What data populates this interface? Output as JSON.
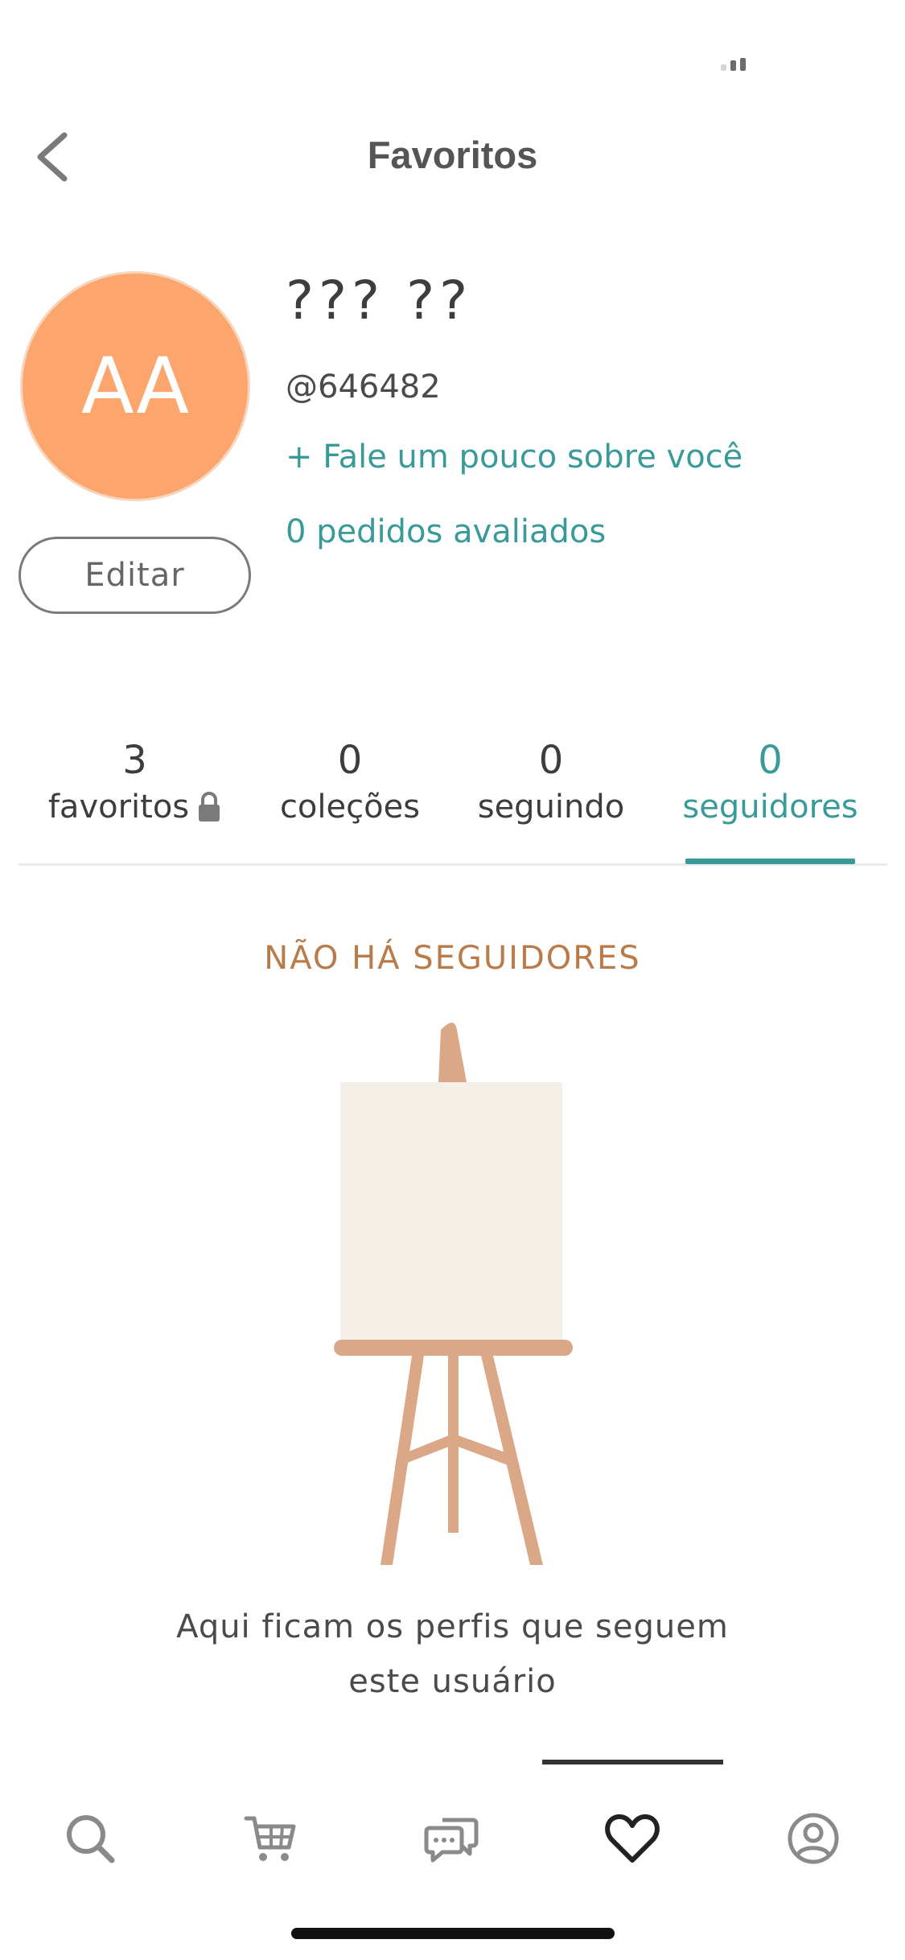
{
  "header": {
    "title": "Favoritos",
    "back_icon": "chevron-left-icon"
  },
  "profile": {
    "avatar_initials": "AA",
    "avatar_color": "#fca56c",
    "name": "??? ??",
    "handle": "@646482",
    "bio_link": "+ Fale um pouco sobre você",
    "reviews": "0 pedidos avaliados",
    "edit_label": "Editar"
  },
  "stats": {
    "favorites": {
      "count": "3",
      "label": "favoritos",
      "icon": "lock-icon"
    },
    "collections": {
      "count": "0",
      "label": "coleções"
    },
    "following": {
      "count": "0",
      "label": "seguindo"
    },
    "followers": {
      "count": "0",
      "label": "seguidores",
      "active": true
    }
  },
  "empty_state": {
    "title": "NÃO HÁ SEGUIDORES",
    "line1": "Aqui ficam os perfis que seguem",
    "line2": "este usuário",
    "illustration": "easel-icon"
  },
  "nav": {
    "items": [
      {
        "icon": "search-icon"
      },
      {
        "icon": "cart-icon"
      },
      {
        "icon": "chat-icon"
      },
      {
        "icon": "heart-icon",
        "active": true
      },
      {
        "icon": "profile-icon"
      }
    ]
  },
  "colors": {
    "accent": "#3a9a9a",
    "empty_title": "#b97b4a",
    "easel_wood": "#dba887",
    "canvas": "#f5f0e7"
  }
}
